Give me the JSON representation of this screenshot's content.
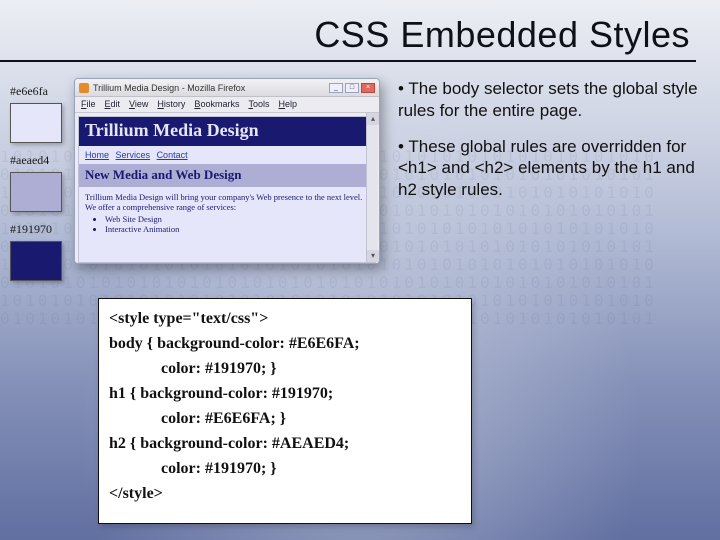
{
  "title": "CSS Embedded Styles",
  "bullets": [
    "The body selector sets the global style rules for the entire page.",
    "These global rules are overridden for <h1> and <h2> elements by the h1 and h2 style rules."
  ],
  "swatches": [
    {
      "label": "#e6e6fa",
      "color": "#E6E6FA"
    },
    {
      "label": "#aeaed4",
      "color": "#AEAED4"
    },
    {
      "label": "#191970",
      "color": "#191970"
    }
  ],
  "browser": {
    "window_title": "Trillium Media Design - Mozilla Firefox",
    "menus": [
      "File",
      "Edit",
      "View",
      "History",
      "Bookmarks",
      "Tools",
      "Help"
    ],
    "h1": "Trillium Media Design",
    "nav": [
      "Home",
      "Services",
      "Contact"
    ],
    "h2": "New Media and Web Design",
    "para": "Trillium Media Design will bring your company's Web presence to the next level. We offer a comprehensive range of services:",
    "list": [
      "Web Site Design",
      "Interactive Animation"
    ]
  },
  "code": {
    "l1": "<style type=\"text/css\">",
    "l2": "body { background-color: #E6E6FA;",
    "l3": "color: #191970; }",
    "l4": "h1 { background-color: #191970;",
    "l5": "color: #E6E6FA; }",
    "l6": "h2 { background-color: #AEAED4;",
    "l7": "color: #191970; }",
    "l8": "</style>"
  }
}
